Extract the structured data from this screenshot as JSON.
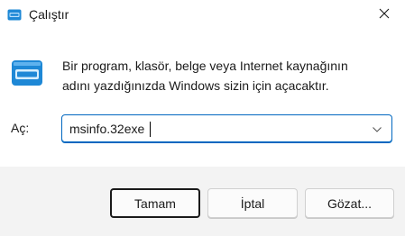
{
  "window": {
    "title": "Çalıştır",
    "icon": "run-icon",
    "close_icon": "close-icon"
  },
  "content": {
    "icon": "run-dialog-icon",
    "description_line1": "Bir program, klasör, belge veya Internet kaynağının",
    "description_line2": "adını yazdığınızda Windows sizin için açacaktır.",
    "open_label": "Aç:",
    "open_value": "msinfo.32exe",
    "dropdown_icon": "chevron-down-icon"
  },
  "buttons": {
    "ok_label": "Tamam",
    "cancel_label": "İptal",
    "browse_label": "Gözat..."
  },
  "colors": {
    "accent": "#0067c0",
    "icon_blue": "#1e88d6",
    "footer_bg": "#f3f3f3"
  }
}
